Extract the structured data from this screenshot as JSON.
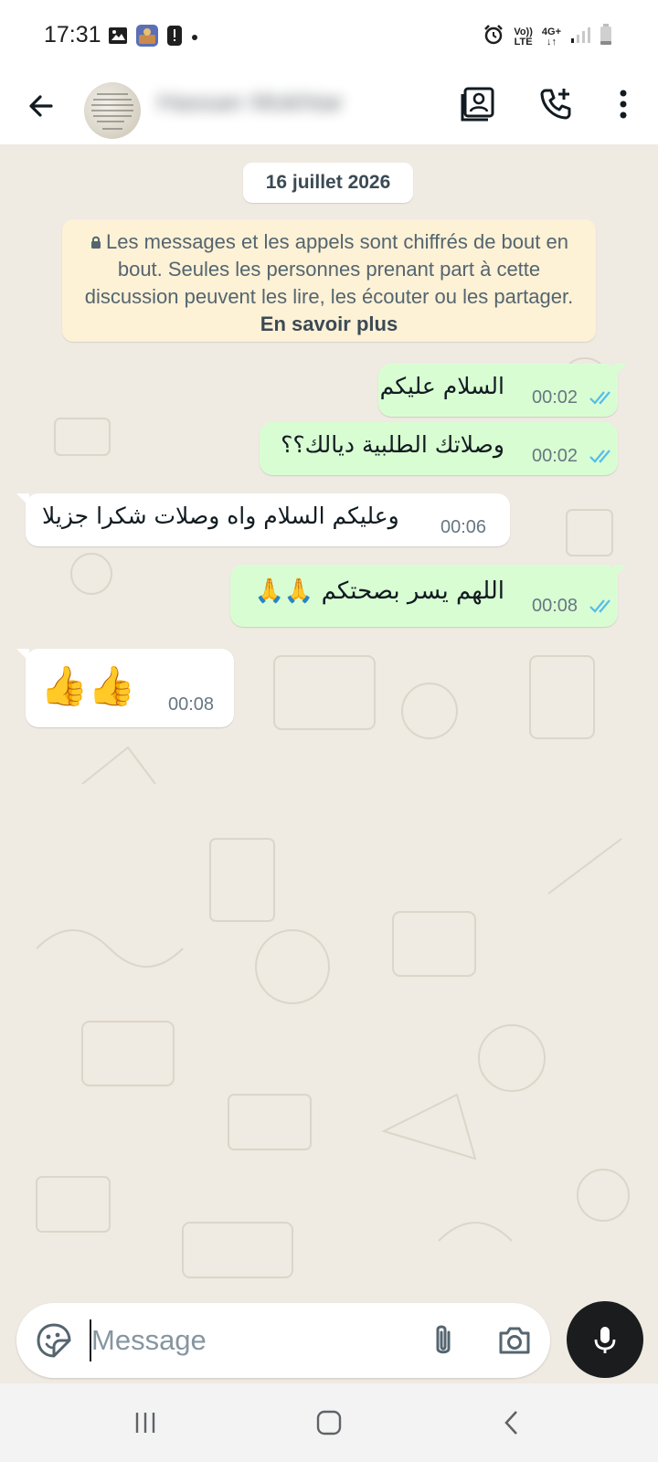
{
  "status_bar": {
    "time": "17:31",
    "network_volte": "Vo))",
    "network_lte": "LTE",
    "network_type": "4G+"
  },
  "header": {
    "contact_name": "Hassan Mokhtar"
  },
  "chat": {
    "date": "16 juillet 2026",
    "encryption_notice": "Les messages et les appels sont chiffrés de bout en bout. Seules les personnes prenant part à cette discussion peuvent les lire, les écouter ou les partager.",
    "learn_more": "En savoir plus",
    "messages": [
      {
        "direction": "out",
        "text": "السلام عليكم",
        "time": "00:02",
        "status": "read"
      },
      {
        "direction": "out",
        "text": "وصلاتك الطلبية ديالك؟؟",
        "time": "00:02",
        "status": "read"
      },
      {
        "direction": "in",
        "text": "وعليكم السلام واه وصلات شكرا جزيلا",
        "time": "00:06"
      },
      {
        "direction": "out",
        "text": "اللهم يسر بصحتكم 🙏🙏",
        "time": "00:08",
        "status": "read"
      },
      {
        "direction": "in",
        "text": "👍👍",
        "time": "00:08"
      }
    ]
  },
  "input": {
    "placeholder": "Message"
  },
  "colors": {
    "outgoing_bubble": "#d9fdd3",
    "incoming_bubble": "#ffffff",
    "chat_background": "#efeae2",
    "read_tick": "#53bdeb",
    "mic_button": "#1a1c1e"
  }
}
